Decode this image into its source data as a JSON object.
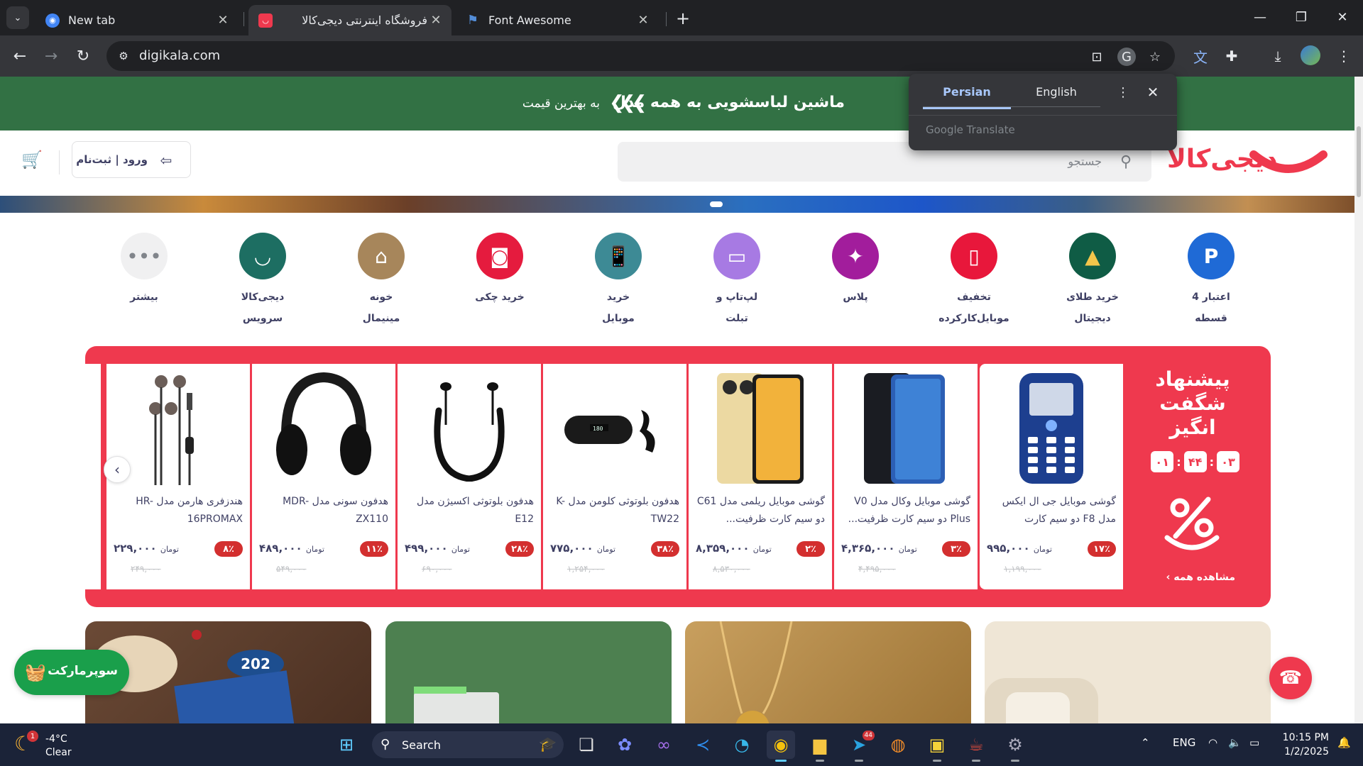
{
  "browser": {
    "tabs": [
      {
        "title": "New tab",
        "favicon": "chrome-newtab-icon",
        "active": false
      },
      {
        "title": "فروشگاه اینترنتی دیجی‌کالا",
        "favicon": "digikala-favicon",
        "active": true
      },
      {
        "title": "Font Awesome",
        "favicon": "font-awesome-flag-icon",
        "active": false
      }
    ],
    "url": "digikala.com",
    "accent": "#a8c7fa"
  },
  "translate_popup": {
    "source_lang": "Persian",
    "target_lang": "English",
    "brand": "Google Translate"
  },
  "page": {
    "promo": {
      "headline": "ماشین لباسشویی به همه مدل",
      "sub": "به بهترین قیمت",
      "bg": "#327144"
    },
    "logo_text": "دیجی‌کالا",
    "brand_color": "#ef394e",
    "search_placeholder": "جستجو",
    "login_label": "ورود | ثبت‌نام",
    "categories": [
      {
        "line1": "اعتبار 4",
        "line2": "قسطه",
        "color": "#1f6ad6",
        "icon": "credit-icon"
      },
      {
        "line1": "خرید طلای",
        "line2": "دیجیتال",
        "color": "#0f5c45",
        "icon": "gold-bars-icon"
      },
      {
        "line1": "تخفیف",
        "line2": "موبایل‌کارکرده",
        "color": "#e8173b",
        "icon": "phone-icon"
      },
      {
        "line1": "پلاس",
        "line2": "",
        "color": "#a21d9c",
        "icon": "plus-star-icon"
      },
      {
        "line1": "لپ‌تاپ و",
        "line2": "تبلت",
        "color": "#a77ae3",
        "icon": "laptop-icon"
      },
      {
        "line1": "خرید",
        "line2": "موبایل",
        "color": "#3d8a95",
        "icon": "mobile-icon"
      },
      {
        "line1": "خرید چکی",
        "line2": "",
        "color": "#e51b3e",
        "icon": "wallet-icon"
      },
      {
        "line1": "خونه",
        "line2": "مینیمال",
        "color": "#a7865b",
        "icon": "home-icon"
      },
      {
        "line1": "دیجی‌کالا",
        "line2": "سرویس",
        "color": "#1d6e62",
        "icon": "smile-icon"
      },
      {
        "line1": "بیشتر",
        "line2": "",
        "color": "#f0f0f1",
        "icon": "more-dots-icon"
      }
    ],
    "amazing": {
      "title_lines": [
        "پیشنهاد",
        "شگفت",
        "انگیز"
      ],
      "timer": [
        "۰۳",
        "۴۴",
        "۰۱"
      ],
      "see_all": "مشاهده همه",
      "products": [
        {
          "name": "گوشی موبایل جی ال ایکس مدل F8 دو سیم کارت",
          "discount": "۱۷٪",
          "price": "۹۹۵,۰۰۰",
          "old_price": "۱,۱۹۹,۰۰۰",
          "image": "feature-phone-image"
        },
        {
          "name": "گوشی موبایل وکال مدل V0 Plus دو سیم کارت ظرفیت...",
          "discount": "۳٪",
          "price": "۴,۳۶۵,۰۰۰",
          "old_price": "۴,۴۹۵,۰۰۰",
          "image": "smartphone-black-image"
        },
        {
          "name": "گوشی موبایل ریلمی مدل C61 دو سیم کارت ظرفیت...",
          "discount": "۲٪",
          "price": "۸,۳۵۹,۰۰۰",
          "old_price": "۸,۵۳۰,۰۰۰",
          "image": "smartphone-gold-image"
        },
        {
          "name": "هدفون بلوتوثی کلومن مدل K-TW22",
          "discount": "۳۸٪",
          "price": "۷۷۵,۰۰۰",
          "old_price": "۱,۲۵۴,۰۰۰",
          "image": "earbuds-case-image"
        },
        {
          "name": "هدفون بلوتوثی اکسیژن مدل E12",
          "discount": "۲۸٪",
          "price": "۴۹۹,۰۰۰",
          "old_price": "۶۹۰,۰۰۰",
          "image": "neckband-earphone-image"
        },
        {
          "name": "هدفون سونی مدل MDR-ZX110",
          "discount": "۱۱٪",
          "price": "۴۸۹,۰۰۰",
          "old_price": "۵۴۹,۰۰۰",
          "image": "headphone-image"
        },
        {
          "name": "هندزفری هارمن مدل HR-16PROMAX",
          "discount": "۸٪",
          "price": "۲۲۹,۰۰۰",
          "old_price": "۲۴۹,۰۰۰",
          "image": "wired-earphone-image"
        }
      ],
      "currency": "تومان"
    },
    "banners": [
      {
        "color": "#efe6d6",
        "name": "furniture-banner"
      },
      {
        "color": "#c89f5e",
        "name": "jewelry-banner"
      },
      {
        "color": "#4d8050",
        "name": "appliance-banner"
      },
      {
        "color": "#6b4a36",
        "name": "food-banner"
      }
    ],
    "supermarket_label": "سوپرمارکت"
  },
  "taskbar": {
    "weather_temp": "-4°C",
    "weather_cond": "Clear",
    "weather_badge": "1",
    "search_label": "Search",
    "telegram_count": "44",
    "lang": "ENG",
    "time": "10:15 PM",
    "date": "1/2/2025"
  }
}
